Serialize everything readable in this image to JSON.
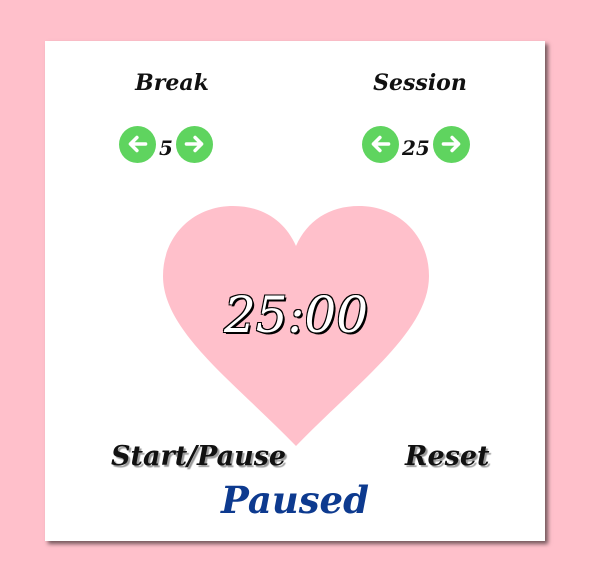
{
  "break": {
    "title": "Break",
    "value": "5"
  },
  "session": {
    "title": "Session",
    "value": "25"
  },
  "timer": {
    "display": "25:00"
  },
  "actions": {
    "start_pause": "Start/Pause",
    "reset": "Reset"
  },
  "status": {
    "text": "Paused"
  },
  "colors": {
    "background": "#ffc0cb",
    "card": "#ffffff",
    "heart": "#ffc0cb",
    "arrow_button": "#5fd45f",
    "status_text": "#0d3a8f"
  },
  "icons": {
    "decrement": "arrow-left-circle-icon",
    "increment": "arrow-right-circle-icon"
  }
}
